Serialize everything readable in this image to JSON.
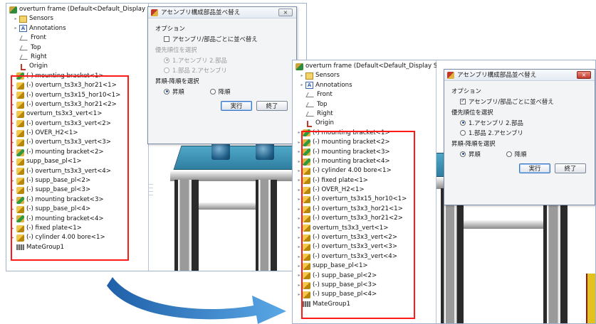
{
  "before": {
    "tree": [
      {
        "icon": "assembly-root-icon",
        "label": "overturn frame  (Default<Default_Display S"
      },
      {
        "icon": "sensors-icon",
        "label": "Sensors"
      },
      {
        "icon": "annotations-icon",
        "label": "Annotations"
      },
      {
        "icon": "plane-icon",
        "label": "Front"
      },
      {
        "icon": "plane-icon",
        "label": "Top"
      },
      {
        "icon": "plane-icon",
        "label": "Right"
      },
      {
        "icon": "origin-icon",
        "label": "Origin"
      },
      {
        "icon": "subassembly-icon",
        "label": "(-) mounting bracket<1>"
      },
      {
        "icon": "part-icon",
        "label": "(-) overturn_ts3x3_hor21<1>"
      },
      {
        "icon": "part-icon",
        "label": "(-) overturn_ts3x15_hor10<1>"
      },
      {
        "icon": "part-icon",
        "label": "(-) overturn_ts3x3_hor21<2>"
      },
      {
        "icon": "part-icon",
        "label": "overturn_ts3x3_vert<1>"
      },
      {
        "icon": "part-icon",
        "label": "(-) overturn_ts3x3_vert<2>"
      },
      {
        "icon": "part-icon",
        "label": "(-) OVER_H2<1>"
      },
      {
        "icon": "part-icon",
        "label": "(-) overturn_ts3x3_vert<3>"
      },
      {
        "icon": "subassembly-icon",
        "label": "(-) mounting bracket<2>"
      },
      {
        "icon": "part-icon",
        "label": "supp_base_pl<1>"
      },
      {
        "icon": "part-icon",
        "label": "(-) overturn_ts3x3_vert<4>"
      },
      {
        "icon": "part-icon",
        "label": "(-) supp_base_pl<2>"
      },
      {
        "icon": "part-icon",
        "label": "(-) supp_base_pl<3>"
      },
      {
        "icon": "subassembly-icon",
        "label": "(-) mounting bracket<3>"
      },
      {
        "icon": "part-icon",
        "label": "(-) supp_base_pl<4>"
      },
      {
        "icon": "subassembly-icon",
        "label": "(-) mounting bracket<4>"
      },
      {
        "icon": "part-icon",
        "label": "(-) fixed plate<1>"
      },
      {
        "icon": "part-icon",
        "label": "(-) cylinder 4.00 bore<1>"
      },
      {
        "icon": "mategroup-icon",
        "label": "MateGroup1"
      }
    ],
    "dialog": {
      "title": "アセンブリ構成部品並べ替え",
      "close": "×",
      "options_label": "オプション",
      "sort_by_type_label": "アセンブリ/部品ごとに並べ替え",
      "sort_by_type_checked": false,
      "priority_label": "優先順位を選択",
      "priority_assembly_first": "1.アセンブリ  2.部品",
      "priority_part_first": "1.部品  2.アセンブリ",
      "priority_selected": "assembly_first",
      "priority_enabled": false,
      "order_label": "昇順-降順を選択",
      "ascending": "昇順",
      "descending": "降順",
      "order_selected": "ascending",
      "run_button": "実行",
      "close_button": "終了"
    }
  },
  "after": {
    "tree": [
      {
        "icon": "assembly-root-icon",
        "label": "overturn frame  (Default<Default_Display S"
      },
      {
        "icon": "sensors-icon",
        "label": "Sensors"
      },
      {
        "icon": "annotations-icon",
        "label": "Annotations"
      },
      {
        "icon": "plane-icon",
        "label": "Front"
      },
      {
        "icon": "plane-icon",
        "label": "Top"
      },
      {
        "icon": "plane-icon",
        "label": "Right"
      },
      {
        "icon": "origin-icon",
        "label": "Origin"
      },
      {
        "icon": "subassembly-icon",
        "label": "(-) mounting bracket<1>"
      },
      {
        "icon": "subassembly-icon",
        "label": "(-) mounting bracket<2>"
      },
      {
        "icon": "subassembly-icon",
        "label": "(-) mounting bracket<3>"
      },
      {
        "icon": "subassembly-icon",
        "label": "(-) mounting bracket<4>"
      },
      {
        "icon": "part-icon",
        "label": "(-) cylinder 4.00 bore<1>"
      },
      {
        "icon": "part-icon",
        "label": "(-) fixed plate<1>"
      },
      {
        "icon": "part-icon",
        "label": "(-) OVER_H2<1>"
      },
      {
        "icon": "part-icon",
        "label": "(-) overturn_ts3x15_hor10<1>"
      },
      {
        "icon": "part-icon",
        "label": "(-) overturn_ts3x3_hor21<1>"
      },
      {
        "icon": "part-icon",
        "label": "(-) overturn_ts3x3_hor21<2>"
      },
      {
        "icon": "part-icon",
        "label": "overturn_ts3x3_vert<1>"
      },
      {
        "icon": "part-icon",
        "label": "(-) overturn_ts3x3_vert<2>"
      },
      {
        "icon": "part-icon",
        "label": "(-) overturn_ts3x3_vert<3>"
      },
      {
        "icon": "part-icon",
        "label": "(-) overturn_ts3x3_vert<4>"
      },
      {
        "icon": "part-icon",
        "label": "supp_base_pl<1>"
      },
      {
        "icon": "part-icon",
        "label": "(-) supp_base_pl<2>"
      },
      {
        "icon": "part-icon",
        "label": "(-) supp_base_pl<3>"
      },
      {
        "icon": "part-icon",
        "label": "(-) supp_base_pl<4>"
      },
      {
        "icon": "mategroup-icon",
        "label": "MateGroup1"
      }
    ],
    "dialog": {
      "title": "アセンブリ構成部品並べ替え",
      "close": "×",
      "options_label": "オプション",
      "sort_by_type_label": "アセンブリ/部品ごとに並べ替え",
      "sort_by_type_checked": true,
      "priority_label": "優先順位を選択",
      "priority_assembly_first": "1.アセンブリ  2.部品",
      "priority_part_first": "1.部品  2.アセンブリ",
      "priority_selected": "assembly_first",
      "priority_enabled": true,
      "order_label": "昇順-降順を選択",
      "ascending": "昇順",
      "descending": "降順",
      "order_selected": "ascending",
      "run_button": "実行",
      "close_button": "終了"
    }
  },
  "colors": {
    "highlight": "#ff1a1a",
    "arrow": "#2f7fc8",
    "deck": "#3f93b8"
  }
}
